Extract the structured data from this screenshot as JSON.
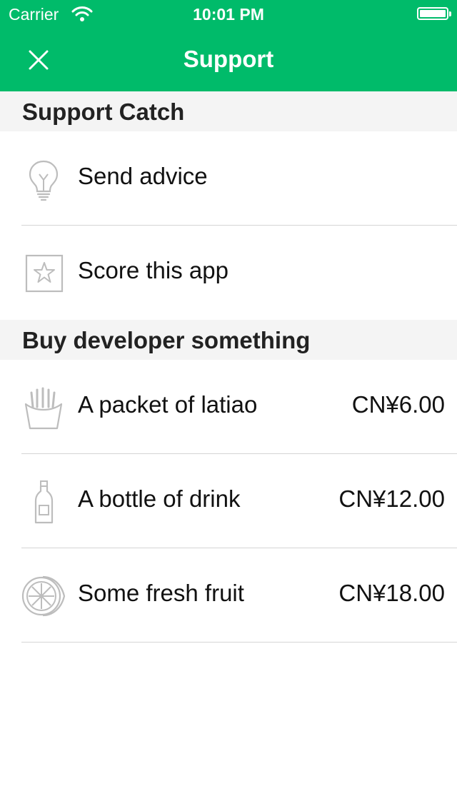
{
  "status_bar": {
    "carrier": "Carrier",
    "time": "10:01 PM"
  },
  "nav": {
    "title": "Support",
    "close_icon": "close-icon"
  },
  "sections": [
    {
      "title": "Support Catch",
      "items": [
        {
          "label": "Send advice",
          "icon": "lightbulb-icon"
        },
        {
          "label": "Score this app",
          "icon": "star-icon"
        }
      ]
    },
    {
      "title": "Buy developer something",
      "items": [
        {
          "label": "A packet of latiao",
          "price": "CN¥6.00",
          "icon": "fries-icon"
        },
        {
          "label": "A bottle of drink",
          "price": "CN¥12.00",
          "icon": "bottle-icon"
        },
        {
          "label": "Some fresh fruit",
          "price": "CN¥18.00",
          "icon": "fruit-icon"
        }
      ]
    }
  ],
  "colors": {
    "accent": "#00bb6a",
    "section_bg": "#f4f4f4",
    "icon_gray": "#bdbdbd",
    "divider": "#d5d5d5"
  }
}
